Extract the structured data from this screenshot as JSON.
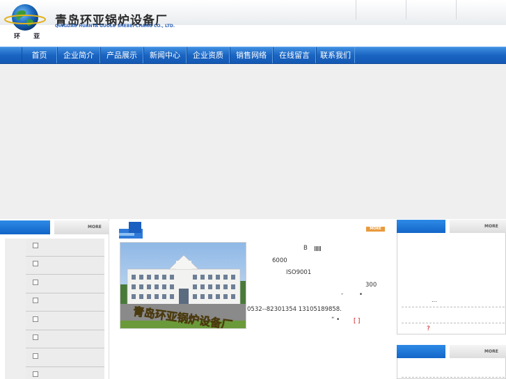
{
  "header": {
    "logo_text": "环 亚",
    "company_name": "青岛环亚锅炉设备厂",
    "company_name_en": "QINGDAO HUANYA GUOLU SHEBEI CHANG CO., LTD."
  },
  "nav": {
    "items": [
      {
        "label": "首页"
      },
      {
        "label": "企业简介"
      },
      {
        "label": "产品展示"
      },
      {
        "label": "新闻中心"
      },
      {
        "label": "企业资质"
      },
      {
        "label": "销售网络"
      },
      {
        "label": "在线留言"
      },
      {
        "label": "联系我们"
      }
    ]
  },
  "more_label": "MORE",
  "center": {
    "photo_sign": "青岛环亚锅炉设备厂",
    "intro_lines": [
      "B",
      "6000",
      "ISO9001",
      "300",
      "-",
      "•",
      "0532--82301354   13105189858.",
      "“ •",
      "[   ]"
    ]
  },
  "right": {
    "ellipsis": "...",
    "question": "?"
  },
  "colors": {
    "nav_blue": "#1a64c2",
    "accent_orange": "#e89a3c",
    "link_red": "#cc0000"
  }
}
